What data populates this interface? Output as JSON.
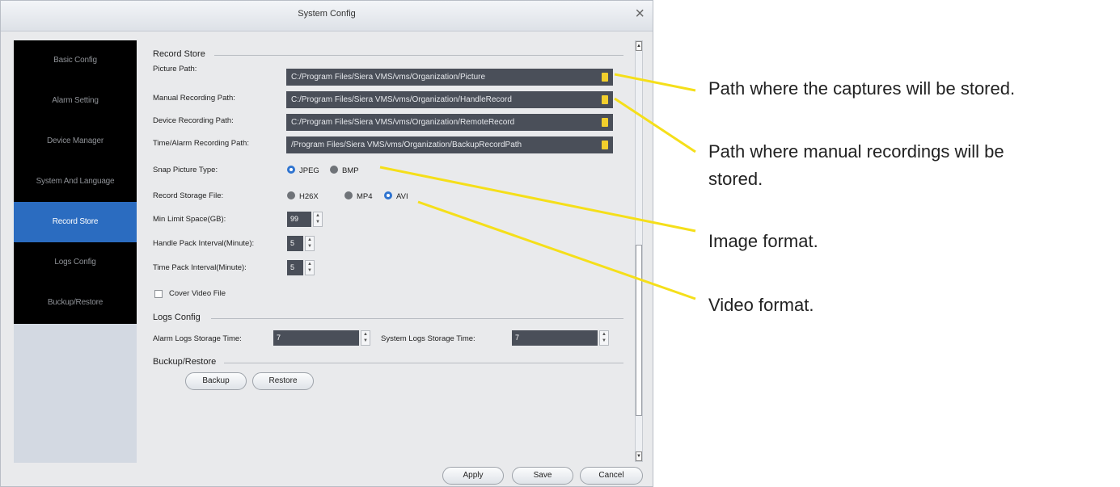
{
  "window": {
    "title": "System Config",
    "close_label": "×"
  },
  "sidebar": {
    "items": [
      {
        "label": "Basic Config"
      },
      {
        "label": "Alarm Setting"
      },
      {
        "label": "Device Manager"
      },
      {
        "label": "System And Language"
      },
      {
        "label": "Record Store",
        "active": true
      },
      {
        "label": "Logs Config"
      },
      {
        "label": "Buckup/Restore"
      }
    ]
  },
  "record_store": {
    "title": "Record Store",
    "picture_path_label": "Picture Path:",
    "picture_path": "C:/Program Files/Siera VMS/vms/Organization/Picture",
    "manual_path_label": "Manual Recording Path:",
    "manual_path": "C:/Program Files/Siera VMS/vms/Organization/HandleRecord",
    "device_path_label": "Device Recording Path:",
    "device_path": "C:/Program Files/Siera VMS/vms/Organization/RemoteRecord",
    "alarm_path_label": "Time/Alarm Recording Path:",
    "alarm_path": "/Program Files/Siera VMS/vms/Organization/BackupRecordPath",
    "snap_type_label": "Snap Picture Type:",
    "snap_options": [
      "JPEG",
      "BMP"
    ],
    "snap_selected": "JPEG",
    "storage_file_label": "Record Storage File:",
    "storage_options": [
      "H26X",
      "MP4",
      "AVI"
    ],
    "storage_selected": "AVI",
    "min_space_label": "Min Limit Space(GB):",
    "min_space": "99",
    "handle_pack_label": "Handle Pack Interval(Minute):",
    "handle_pack": "5",
    "time_pack_label": "Time Pack Interval(Minute):",
    "time_pack": "5",
    "cover_video_label": "Cover Video File",
    "cover_video_checked": false
  },
  "logs_config": {
    "title": "Logs Config",
    "alarm_label": "Alarm Logs Storage Time:",
    "alarm_value": "7",
    "system_label": "System Logs Storage Time:",
    "system_value": "7"
  },
  "backup_restore": {
    "title": "Buckup/Restore",
    "backup_label": "Backup",
    "restore_label": "Restore"
  },
  "footer": {
    "apply_label": "Apply",
    "save_label": "Save",
    "cancel_label": "Cancel"
  },
  "annotations": {
    "picture_path": "Path where the captures will be stored.",
    "manual_path_line1": "Path where manual recordings will be",
    "manual_path_line2": "stored.",
    "image_format": "Image format.",
    "video_format": "Video format."
  },
  "colors": {
    "accent": "#2b6cc0",
    "highlight": "#f5df1a",
    "field_bg": "#4a4f59"
  },
  "icons": {
    "folder": "folder-icon",
    "close": "close-icon"
  }
}
